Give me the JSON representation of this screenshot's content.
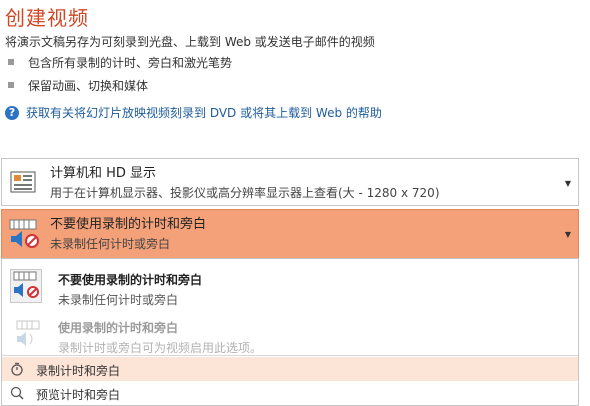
{
  "header": {
    "title": "创建视频",
    "subtitle": "将演示文稿另存为可刻录到光盘、上载到 Web 或发送电子邮件的视频",
    "bullets": [
      "包含所有录制的计时、旁白和激光笔势",
      "保留动画、切换和媒体"
    ],
    "help_link": "获取有关将幻灯片放映视频刻录到 DVD 或将其上载到 Web 的帮助"
  },
  "quality_dropdown": {
    "title": "计算机和 HD 显示",
    "description": "用于在计算机显示器、投影仪或高分辨率显示器上查看(大 - 1280 x 720)"
  },
  "timing_dropdown": {
    "title": "不要使用录制的计时和旁白",
    "description": "未录制任何计时或旁白",
    "highlight_color": "#f4a179"
  },
  "timing_menu": {
    "options": [
      {
        "title": "不要使用录制的计时和旁白",
        "description": "未录制任何计时或旁白",
        "enabled": true
      },
      {
        "title": "使用录制的计时和旁白",
        "description": "录制计时或旁白可为视频启用此选项。",
        "enabled": false
      }
    ],
    "actions": [
      {
        "label": "录制计时和旁白",
        "icon": "record-timing-icon",
        "hovered": true
      },
      {
        "label": "预览计时和旁白",
        "icon": "preview-timing-icon",
        "hovered": false
      }
    ]
  },
  "colors": {
    "accent": "#d24726",
    "link": "#1f5c9c",
    "hover": "#fce4d6"
  }
}
